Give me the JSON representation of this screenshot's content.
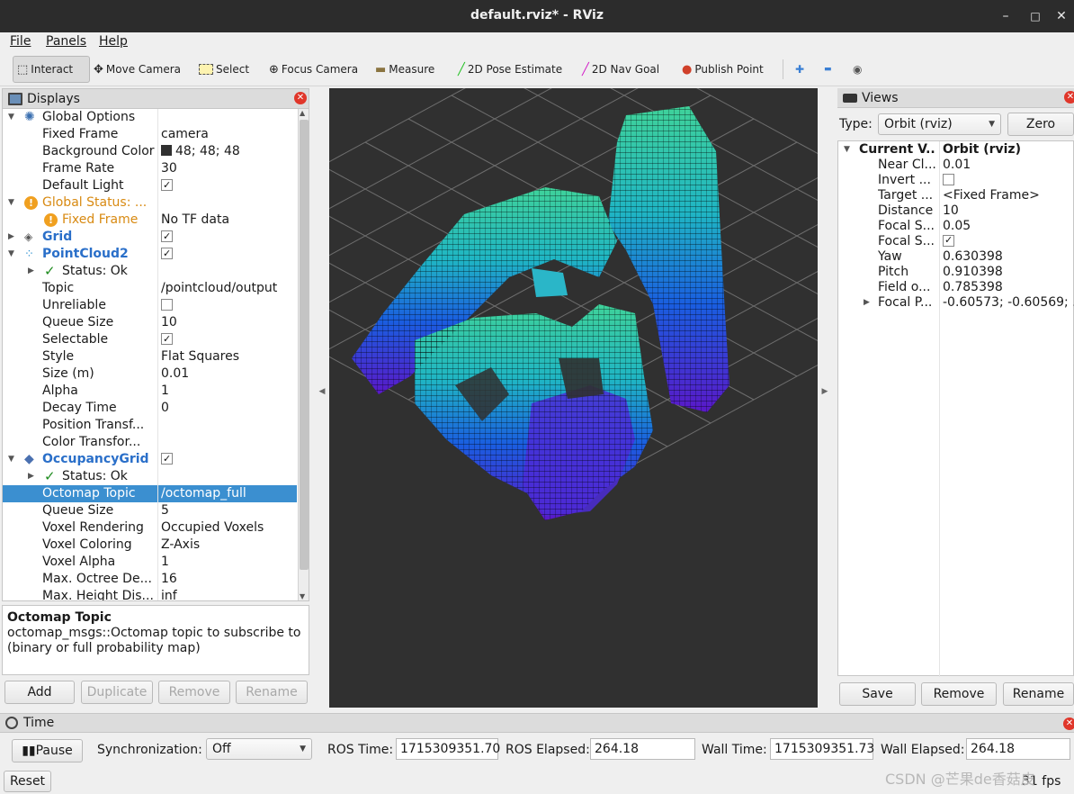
{
  "window": {
    "title": "default.rviz* - RViz",
    "min": "–",
    "max": "□",
    "close": "✕"
  },
  "menu": {
    "file": "File",
    "panels": "Panels",
    "help": "Help"
  },
  "toolbar": {
    "interact": "Interact",
    "move_camera": "Move Camera",
    "select": "Select",
    "focus_camera": "Focus Camera",
    "measure": "Measure",
    "pose_estimate": "2D Pose Estimate",
    "nav_goal": "2D Nav Goal",
    "publish_point": "Publish Point",
    "plus": "✚",
    "minus": "▬",
    "eye": "◉"
  },
  "displays": {
    "title": "Displays",
    "rows": [
      {
        "k": "Global Options",
        "v": ""
      },
      {
        "k": "Fixed Frame",
        "v": "camera"
      },
      {
        "k": "Background Color",
        "v": "48; 48; 48"
      },
      {
        "k": "Frame Rate",
        "v": "30"
      },
      {
        "k": "Default Light",
        "v": ""
      },
      {
        "k": "Global Status: ...",
        "v": ""
      },
      {
        "k": "Fixed Frame",
        "v": "No TF data"
      },
      {
        "k": "Grid",
        "v": ""
      },
      {
        "k": "PointCloud2",
        "v": ""
      },
      {
        "k": "Status: Ok",
        "v": ""
      },
      {
        "k": "Topic",
        "v": "/pointcloud/output"
      },
      {
        "k": "Unreliable",
        "v": ""
      },
      {
        "k": "Queue Size",
        "v": "10"
      },
      {
        "k": "Selectable",
        "v": ""
      },
      {
        "k": "Style",
        "v": "Flat Squares"
      },
      {
        "k": "Size (m)",
        "v": "0.01"
      },
      {
        "k": "Alpha",
        "v": "1"
      },
      {
        "k": "Decay Time",
        "v": "0"
      },
      {
        "k": "Position Transf...",
        "v": ""
      },
      {
        "k": "Color Transfor...",
        "v": ""
      },
      {
        "k": "OccupancyGrid",
        "v": ""
      },
      {
        "k": "Status: Ok",
        "v": ""
      },
      {
        "k": "Octomap Topic",
        "v": "/octomap_full"
      },
      {
        "k": "Queue Size",
        "v": "5"
      },
      {
        "k": "Voxel Rendering",
        "v": "Occupied Voxels"
      },
      {
        "k": "Voxel Coloring",
        "v": "Z-Axis"
      },
      {
        "k": "Voxel Alpha",
        "v": "1"
      },
      {
        "k": "Max. Octree De...",
        "v": "16"
      },
      {
        "k": "Max. Height Dis...",
        "v": "inf"
      }
    ]
  },
  "description": {
    "title": "Octomap Topic",
    "text": "octomap_msgs::Octomap topic to subscribe to (binary or full probability map)"
  },
  "display_buttons": {
    "add": "Add",
    "duplicate": "Duplicate",
    "remove": "Remove",
    "rename": "Rename"
  },
  "views": {
    "title": "Views",
    "type_label": "Type:",
    "type_value": "Orbit (rviz)",
    "zero": "Zero",
    "current_key": "Current V...",
    "current_val": "Orbit (rviz)",
    "rows": [
      {
        "k": "Near Cl...",
        "v": "0.01"
      },
      {
        "k": "Invert ...",
        "v": ""
      },
      {
        "k": "Target ...",
        "v": "<Fixed Frame>"
      },
      {
        "k": "Distance",
        "v": "10"
      },
      {
        "k": "Focal S...",
        "v": "0.05"
      },
      {
        "k": "Focal S...",
        "v": ""
      },
      {
        "k": "Yaw",
        "v": "0.630398"
      },
      {
        "k": "Pitch",
        "v": "0.910398"
      },
      {
        "k": "Field o...",
        "v": "0.785398"
      },
      {
        "k": "Focal P...",
        "v": "-0.60573; -0.60569; ..."
      }
    ],
    "save": "Save",
    "remove": "Remove",
    "rename": "Rename"
  },
  "time": {
    "title": "Time",
    "pause": "Pause",
    "sync_label": "Synchronization:",
    "sync_value": "Off",
    "ros_time_label": "ROS Time:",
    "ros_time": "1715309351.70",
    "ros_elapsed_label": "ROS Elapsed:",
    "ros_elapsed": "264.18",
    "wall_time_label": "Wall Time:",
    "wall_time": "1715309351.73",
    "wall_elapsed_label": "Wall Elapsed:",
    "wall_elapsed": "264.18",
    "reset": "Reset",
    "fps": "31 fps"
  },
  "watermark": "CSDN @芒果de香菇皮"
}
